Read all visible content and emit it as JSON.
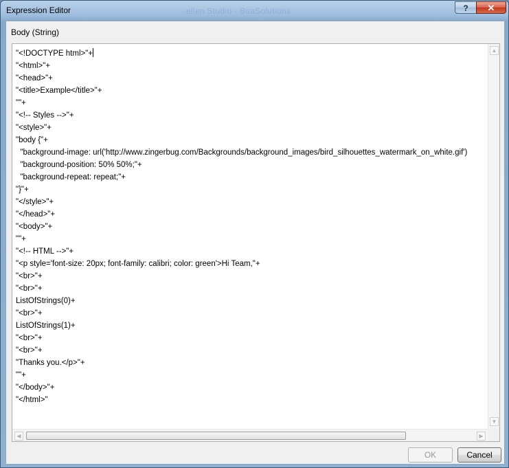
{
  "window": {
    "title": "Expression Editor",
    "background_title": "ellen Studio - BuaSolutions",
    "help_label": "?",
    "close_label": "✕"
  },
  "editor": {
    "label": "Body (String)",
    "lines": [
      "\"<!DOCTYPE html>\"+",
      "\"<html>\"+",
      "\"<head>\"+",
      "\"<title>Example</title>\"+",
      "\"\"+",
      "\"<!-- Styles -->\"+",
      "\"<style>\"+",
      "\"body {\"+",
      "  \"background-image: url('http://www.zingerbug.com/Backgrounds/background_images/bird_silhouettes_watermark_on_white.gif')",
      "  \"background-position: 50% 50%;\"+",
      "  \"background-repeat: repeat;\"+",
      "\"}\"+",
      "\"</style>\"+",
      "\"</head>\"+",
      "\"<body>\"+",
      "\"\"+",
      "\"<!-- HTML -->\"+",
      "\"<p style='font-size: 20px; font-family: calibri; color: green'>Hi Team,\"+",
      "\"<br>\"+",
      "\"<br>\"+",
      "ListOfStrings(0)+",
      "\"<br>\"+",
      "ListOfStrings(1)+",
      "\"<br>\"+",
      "\"<br>\"+",
      "\"Thanks you.</p>\"+",
      "\"\"+",
      "\"</body>\"+",
      "\"</html>\""
    ]
  },
  "scrollbars": {
    "up_arrow": "▲",
    "down_arrow": "▼",
    "left_arrow": "◀",
    "right_arrow": "▶"
  },
  "buttons": {
    "ok_label": "OK",
    "cancel_label": "Cancel"
  }
}
